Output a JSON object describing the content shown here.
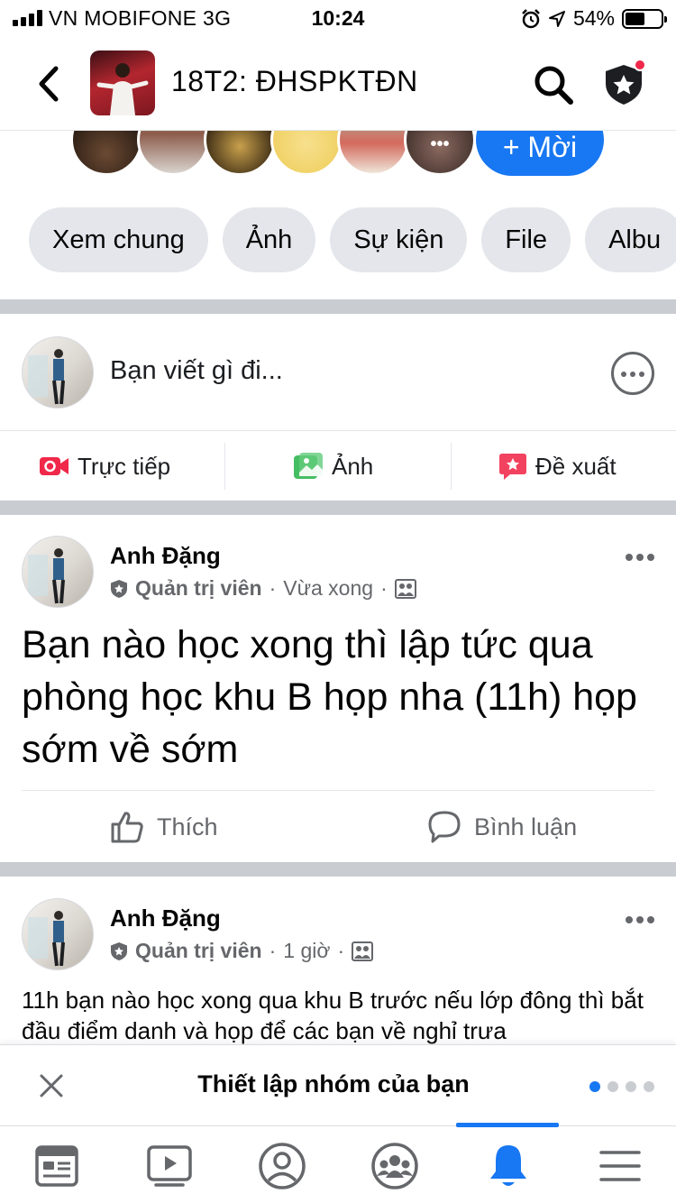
{
  "status_bar": {
    "carrier": "VN MOBIFONE  3G",
    "time": "10:24",
    "battery_text": "54%",
    "battery_level": 0.54
  },
  "header": {
    "group_name": "18T2: ĐHSPKTĐN",
    "icons": [
      "back-chevron-icon",
      "search-icon",
      "admin-shield-star-icon"
    ],
    "notification_dot_color": "#f02849"
  },
  "members": {
    "more_label": "•••",
    "invite_label": "+ Mời"
  },
  "tabs": [
    "Xem chung",
    "Ảnh",
    "Sự kiện",
    "File",
    "Albu"
  ],
  "composer": {
    "placeholder": "Bạn viết gì đi...",
    "actions": [
      {
        "label": "Trực tiếp",
        "icon": "live-video-icon",
        "color": "#f02849"
      },
      {
        "label": "Ảnh",
        "icon": "photo-icon",
        "color": "#45bd62"
      },
      {
        "label": "Đề xuất",
        "icon": "recommend-icon",
        "color": "#f3425f"
      }
    ]
  },
  "posts": [
    {
      "author": "Anh Đặng",
      "role": "Quản trị viên",
      "time": "Vừa xong",
      "audience_icon": "group-audience-icon",
      "body": "Bạn nào học xong thì lập tức qua phòng học khu B họp nha (11h) họp sớm về sớm",
      "actions": {
        "like": "Thích",
        "comment": "Bình luận"
      }
    },
    {
      "author": "Anh Đặng",
      "role": "Quản trị viên",
      "time": "1 giờ",
      "audience_icon": "group-audience-icon",
      "body": "11h bạn nào học xong qua khu B trước nếu lớp đông thì bắt đầu điểm danh và họp để các bạn về nghỉ trưa"
    }
  ],
  "setup_banner": {
    "title": "Thiết lập nhóm của bạn",
    "active_dot_color": "#1877f2"
  },
  "bottom_nav": {
    "items": [
      "feed-icon",
      "watch-icon",
      "profile-icon",
      "groups-icon",
      "notifications-bell-icon",
      "menu-icon"
    ],
    "active": "notifications-bell-icon",
    "accent": "#1877f2"
  }
}
